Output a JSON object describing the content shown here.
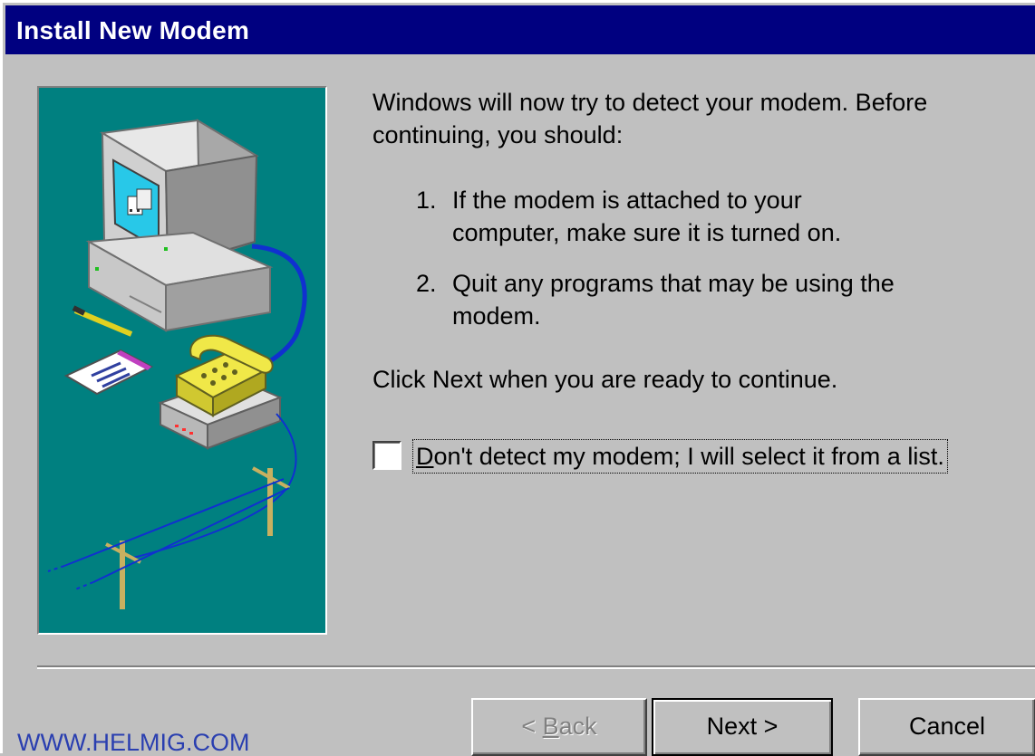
{
  "window": {
    "title": "Install New Modem"
  },
  "content": {
    "intro": "Windows will now try to detect your modem.  Before continuing, you should:",
    "intro_line1": "Windows will now try to detect your modem.  Before",
    "intro_line2": "continuing, you should:",
    "steps": [
      {
        "number": "1.",
        "line1": "If the modem is attached to your",
        "line2": "computer, make sure it is turned on."
      },
      {
        "number": "2.",
        "line1": "Quit any programs that may be using the",
        "line2": "modem."
      }
    ],
    "instruction": "Click Next when you are ready to continue."
  },
  "checkbox": {
    "label_prefix": "D",
    "label_rest": "on't detect my modem; I will select it from a list.",
    "checked": false
  },
  "buttons": {
    "back": {
      "prefix": "< ",
      "accel": "B",
      "rest": "ack",
      "enabled": false
    },
    "next": "Next >",
    "cancel": "Cancel"
  },
  "watermark": "WWW.HELMIG.COM",
  "colors": {
    "titlebar": "#000080",
    "face": "#c0c0c0",
    "illustration_bg": "#008080"
  },
  "icons": [
    "computer-illustration",
    "telephone-icon",
    "modem-icon",
    "pencil-icon",
    "notepad-icon",
    "telephone-pole-icon"
  ]
}
